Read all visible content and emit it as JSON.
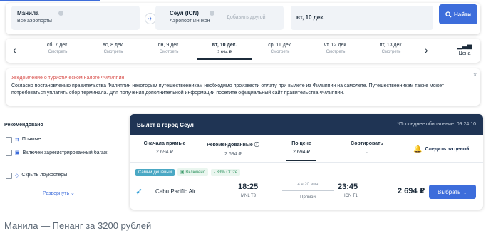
{
  "search": {
    "from_city": "Манила",
    "from_sub": "Все аэропорты",
    "to_city": "Сеул (ICN)",
    "to_sub": "Аэропорт Инчхон",
    "add_other": "Добавить другой",
    "date": "вт, 10 дек.",
    "search_button": "Найти"
  },
  "dates": [
    {
      "day": "сб, 7 дек.",
      "price": "Смотреть"
    },
    {
      "day": "вс, 8 дек.",
      "price": "Смотреть"
    },
    {
      "day": "пн, 9 дек.",
      "price": "Смотреть"
    },
    {
      "day": "вт, 10 дек.",
      "price": "2 694 ₽"
    },
    {
      "day": "ср, 11 дек.",
      "price": "Смотреть"
    },
    {
      "day": "чт, 12 дек.",
      "price": "Смотреть"
    },
    {
      "day": "пт, 13 дек.",
      "price": "Смотреть"
    }
  ],
  "price_toggle": "Цена",
  "notice": {
    "title": "Уведомление о туристическом налоге Филиппин",
    "text": "Согласно постановлению правительства Филиппин некоторым путешественникам необходимо произвести оплату при вылете из Филиппин на самолете. Путешественникам также может потребоваться уплатить сбор терминала. Для получения дополнительной информации посетите официальный сайт правительства Филиппин."
  },
  "filters": {
    "title": "Рекомендовано",
    "items": [
      "Прямые",
      "Включен зарегистрированный багаж",
      "Скрыть лоукостеры"
    ],
    "expand": "Развернуть"
  },
  "results": {
    "title": "Вылет в город Сеул",
    "updated": "*Последнее обновление: 09:24:10",
    "sort": [
      {
        "label": "Сначала прямые",
        "price": "2 694 ₽"
      },
      {
        "label": "Рекомендованные",
        "price": "2 694 ₽"
      },
      {
        "label": "По цене",
        "price": "2 694 ₽"
      },
      {
        "label": "Сортировать",
        "price": ""
      }
    ],
    "follow": "Следить за ценой",
    "flight": {
      "badge_cheapest": "Самый дешевый",
      "badge_baggage": "Включено",
      "badge_co2": "- 33% CO2e",
      "airline": "Cebu Pacific Air",
      "dep_time": "18:25",
      "dep_airport": "MNL T3",
      "duration": "4 ч 20 мин",
      "stops": "Прямой",
      "arr_time": "23:45",
      "arr_airport": "ICN T1",
      "price": "2 694 ₽",
      "select_button": "Выбрать"
    }
  },
  "caption": "Манила — Пенанг за 3200 рублей"
}
